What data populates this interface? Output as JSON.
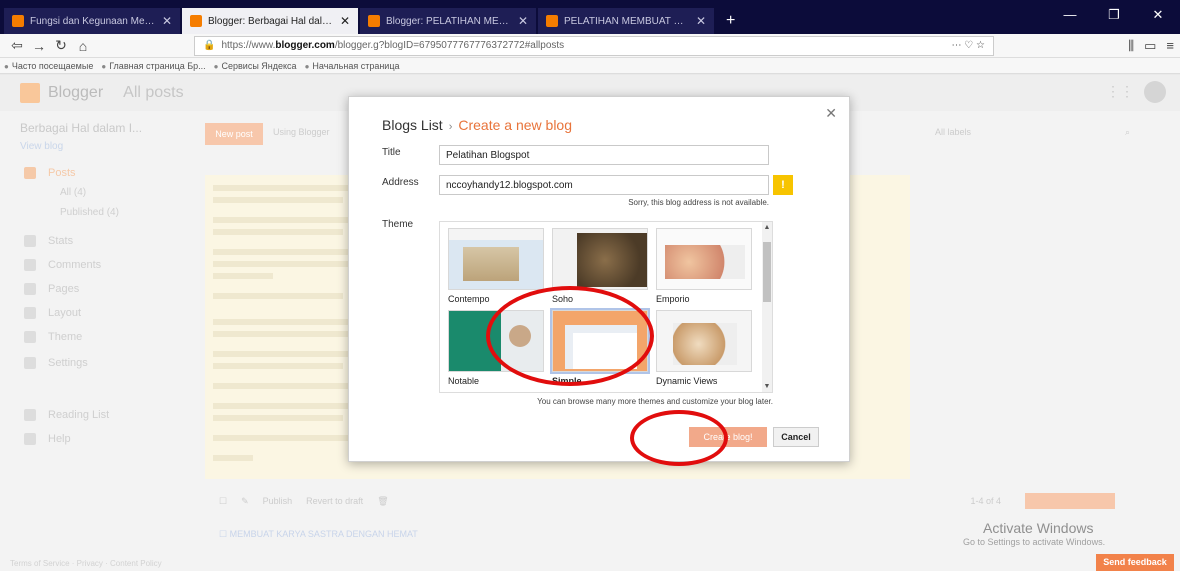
{
  "browser": {
    "tabs": [
      {
        "label": "Fungsi dan Kegunaan Menu-Me",
        "active": false
      },
      {
        "label": "Blogger: Berbagai Hal dalam I",
        "active": true
      },
      {
        "label": "Blogger: PELATIHAN MEMBUA",
        "active": false
      },
      {
        "label": "PELATIHAN MEMBUAT BLOG",
        "active": false
      }
    ],
    "url_prefix": "https://www.",
    "url_domain": "blogger.com",
    "url_rest": "/blogger.g?blogID=6795077767776372772#allposts",
    "bookmarks": [
      "Часто посещаемые",
      "Главная страница Бр...",
      "Сервисы Яндекса",
      "Начальная страница"
    ]
  },
  "blogger": {
    "app_name": "Blogger",
    "section": "All posts",
    "blog_selector": "Berbagai Hal dalam I...",
    "view_blog": "View blog",
    "new_post": "New post",
    "using": "Using Blogger",
    "filter": "All labels",
    "sidebar": [
      {
        "label": "Posts",
        "active": true
      },
      {
        "label": "All (4)",
        "sub": true
      },
      {
        "label": "Published (4)",
        "sub": true
      },
      {
        "label": "Stats"
      },
      {
        "label": "Comments"
      },
      {
        "label": "Pages"
      },
      {
        "label": "Layout"
      },
      {
        "label": "Theme"
      },
      {
        "label": "Settings"
      },
      {
        "label": "Reading List"
      },
      {
        "label": "Help"
      }
    ],
    "footer": "Terms of Service · Privacy · Content Policy",
    "bulk_actions": [
      "Publish",
      "Revert to draft"
    ],
    "pager": "1-4 of 4",
    "post_title": "MEMBUAT KARYA SASTRA DENGAN HEMAT"
  },
  "windows": {
    "activate_title": "Activate Windows",
    "activate_sub": "Go to Settings to activate Windows."
  },
  "send_feedback": "Send feedback",
  "modal": {
    "crumb_parent": "Blogs List",
    "crumb_current": "Create a new blog",
    "title_label": "Title",
    "title_value": "Pelatihan Blogspot",
    "address_label": "Address",
    "address_value": "nccoyhandy12.blogspot.com",
    "address_error": "Sorry, this blog address is not available.",
    "theme_label": "Theme",
    "themes": [
      {
        "name": "Contempo",
        "selected": false
      },
      {
        "name": "Soho",
        "selected": false
      },
      {
        "name": "Emporio",
        "selected": false
      },
      {
        "name": "Notable",
        "selected": false
      },
      {
        "name": "Simple",
        "selected": true
      },
      {
        "name": "Dynamic Views",
        "selected": false
      }
    ],
    "browse_note": "You can browse many more themes and customize your blog later.",
    "create_button": "Create blog!",
    "cancel_button": "Cancel"
  },
  "colors": {
    "accent": "#e8743b",
    "annotation": "#e10d0d",
    "warning": "#f7c400"
  }
}
